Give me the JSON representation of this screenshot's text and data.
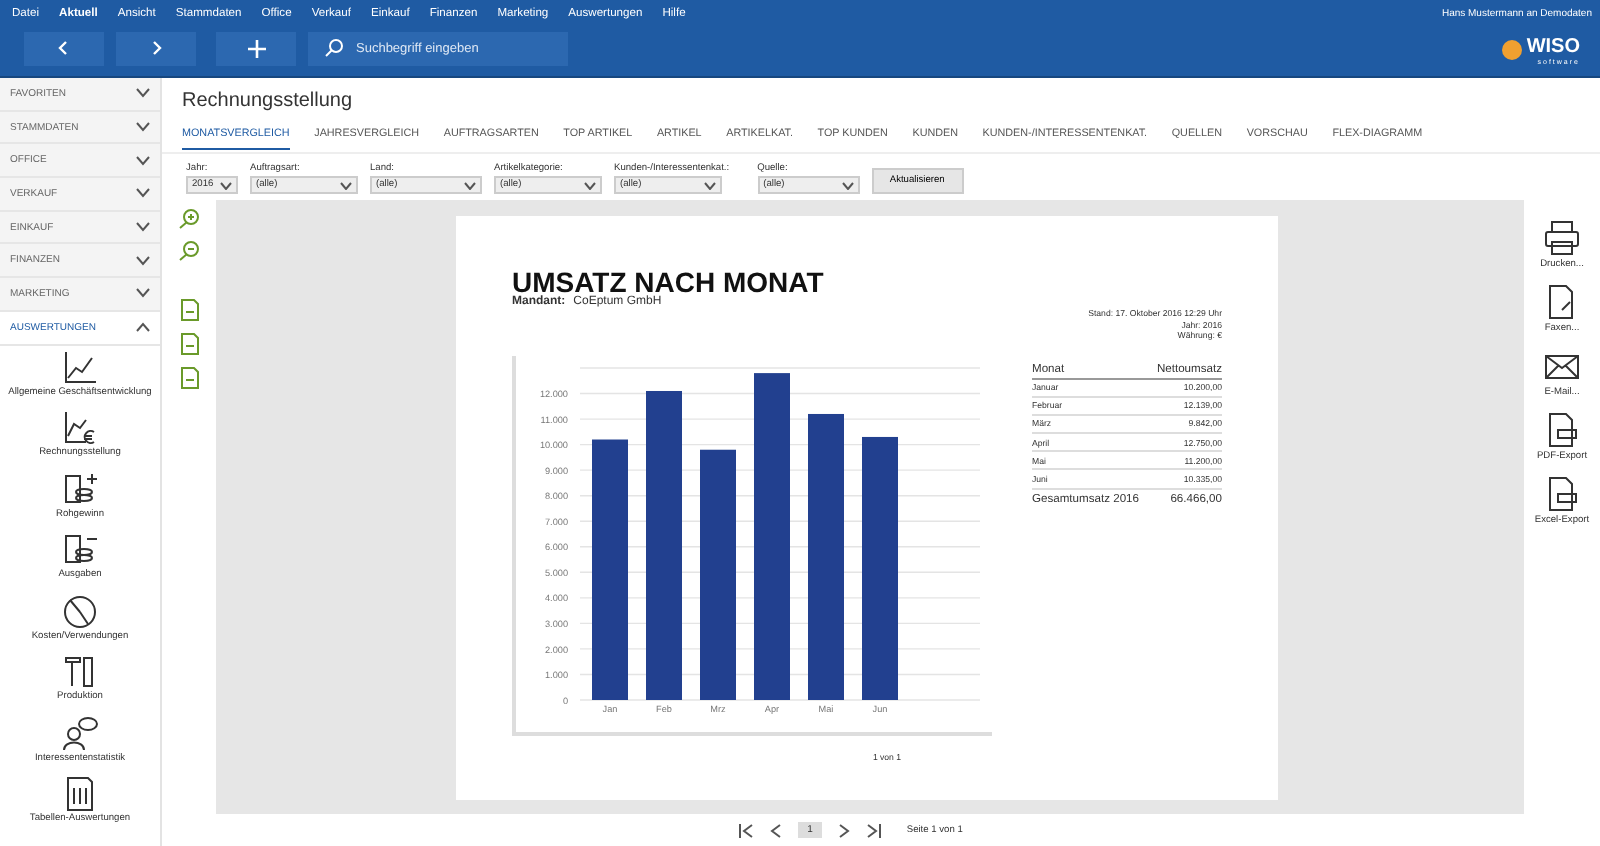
{
  "menu": [
    {
      "label": "Datei",
      "selected": false
    },
    {
      "label": "Aktuell",
      "selected": true
    },
    {
      "label": "Ansicht",
      "selected": false
    },
    {
      "label": "Stammdaten",
      "selected": false
    },
    {
      "label": "Office",
      "selected": false
    },
    {
      "label": "Verkauf",
      "selected": false
    },
    {
      "label": "Einkauf",
      "selected": false
    },
    {
      "label": "Finanzen",
      "selected": false
    },
    {
      "label": "Marketing",
      "selected": false
    },
    {
      "label": "Auswertungen",
      "selected": false
    },
    {
      "label": "Hilfe",
      "selected": false
    }
  ],
  "user": "Hans Mustermann an Demodaten",
  "logo": {
    "name": "WISO",
    "sub": "software"
  },
  "search": {
    "placeholder": "Suchbegriff eingeben"
  },
  "sidebar": {
    "sections": [
      {
        "label": "FAVORITEN",
        "expanded": false
      },
      {
        "label": "STAMMDATEN",
        "expanded": false
      },
      {
        "label": "OFFICE",
        "expanded": false
      },
      {
        "label": "VERKAUF",
        "expanded": false
      },
      {
        "label": "EINKAUF",
        "expanded": false
      },
      {
        "label": "FINANZEN",
        "expanded": false
      },
      {
        "label": "MARKETING",
        "expanded": false
      },
      {
        "label": "AUSWERTUNGEN",
        "expanded": true
      }
    ],
    "items": [
      {
        "label": "Allgemeine Geschäftsentwicklung",
        "kind": "trend"
      },
      {
        "label": "Rechnungsstellung",
        "kind": "euro"
      },
      {
        "label": "Rohgewinn",
        "kind": "plus"
      },
      {
        "label": "Ausgaben",
        "kind": "minus"
      },
      {
        "label": "Kosten/Verwendungen",
        "kind": "pie"
      },
      {
        "label": "Produktion",
        "kind": "tools"
      },
      {
        "label": "Interessentenstatistik",
        "kind": "people"
      },
      {
        "label": "Tabellen-Auswertungen",
        "kind": "table"
      }
    ]
  },
  "title": "Rechnungsstellung",
  "tabs": [
    {
      "label": "MONATSVERGLEICH",
      "selected": true
    },
    {
      "label": "JAHRESVERGLEICH",
      "selected": false
    },
    {
      "label": "AUFTRAGSARTEN",
      "selected": false
    },
    {
      "label": "TOP ARTIKEL",
      "selected": false
    },
    {
      "label": "ARTIKEL",
      "selected": false
    },
    {
      "label": "ARTIKELKAT.",
      "selected": false
    },
    {
      "label": "TOP KUNDEN",
      "selected": false
    },
    {
      "label": "KUNDEN",
      "selected": false
    },
    {
      "label": "KUNDEN-/INTERESSENTENKAT.",
      "selected": false
    },
    {
      "label": "QUELLEN",
      "selected": false
    },
    {
      "label": "VORSCHAU",
      "selected": false
    },
    {
      "label": "FLEX-DIAGRAMM",
      "selected": false
    }
  ],
  "filters": [
    {
      "label": "Jahr:",
      "value": "2016"
    },
    {
      "label": "Auftragsart:",
      "value": "(alle)"
    },
    {
      "label": "Land:",
      "value": "(alle)"
    },
    {
      "label": "Artikelkategorie:",
      "value": "(alle)"
    },
    {
      "label": "Kunden-/Interessentenkat.:",
      "value": "(alle)"
    },
    {
      "label": "Quelle:",
      "value": "(alle)"
    }
  ],
  "refresh_button": "Aktualisieren",
  "report": {
    "title": "UMSATZ NACH MONAT",
    "client_label": "Mandant:",
    "client": "CoEptum GmbH",
    "meta": [
      "Stand: 17. Oktober 2016 12:29 Uhr",
      "Jahr: 2016",
      "Währung: €"
    ],
    "chart_data": {
      "type": "bar",
      "grid": true,
      "categories": [
        "Jan",
        "Feb",
        "Mrz",
        "Apr",
        "Mai",
        "Jun"
      ],
      "values": [
        10200,
        12100,
        9800,
        12800,
        11200,
        10300
      ],
      "ylim": [
        0,
        13000
      ],
      "yticks": [
        {
          "value": 0,
          "label": "0"
        },
        {
          "value": 1000,
          "label": "1.000"
        },
        {
          "value": 2000,
          "label": "2.000"
        },
        {
          "value": 3000,
          "label": "3.000"
        },
        {
          "value": 4000,
          "label": "4.000"
        },
        {
          "value": 5000,
          "label": "5.000"
        },
        {
          "value": 6000,
          "label": "6.000"
        },
        {
          "value": 7000,
          "label": "7.000"
        },
        {
          "value": 8000,
          "label": "8.000"
        },
        {
          "value": 9000,
          "label": "9.000"
        },
        {
          "value": 10000,
          "label": "10.000"
        },
        {
          "value": 11000,
          "label": "11.000"
        },
        {
          "value": 12000,
          "label": "12.000"
        }
      ]
    },
    "table": {
      "columns": [
        "Monat",
        "Nettoumsatz"
      ],
      "rows": [
        [
          "Januar",
          "10.200,00"
        ],
        [
          "Februar",
          "12.139,00"
        ],
        [
          "März",
          "9.842,00"
        ],
        [
          "April",
          "12.750,00"
        ],
        [
          "Mai",
          "11.200,00"
        ],
        [
          "Juni",
          "10.335,00"
        ]
      ],
      "total": [
        "Gesamtumsatz 2016",
        "66.466,00"
      ]
    },
    "footer": "1 von 1"
  },
  "pager": {
    "page": "1",
    "info": "Seite 1 von 1"
  },
  "actions": [
    {
      "label": "Drucken...",
      "kind": "print"
    },
    {
      "label": "Faxen...",
      "kind": "fax"
    },
    {
      "label": "E-Mail...",
      "kind": "mail"
    },
    {
      "label": "PDF-Export",
      "kind": "pdf"
    },
    {
      "label": "Excel-Export",
      "kind": "excel"
    }
  ]
}
